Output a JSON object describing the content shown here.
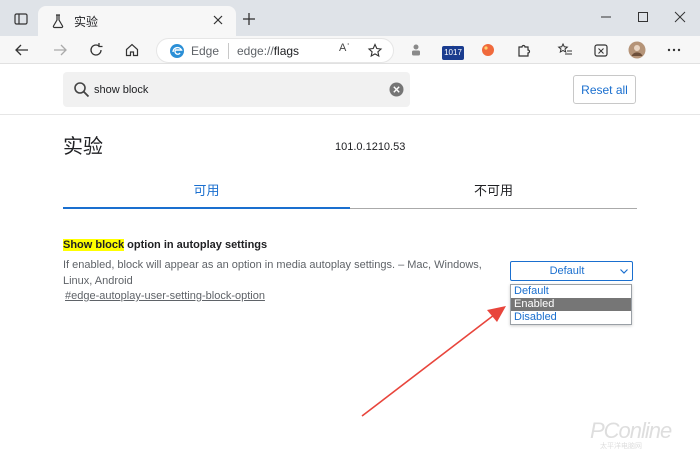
{
  "browser": {
    "tab_title": "实验",
    "site_name": "Edge",
    "url_prefix": "edge://",
    "url_path": "flags",
    "read_aloud_label": "Aʾ",
    "extension_badge": "1017"
  },
  "search": {
    "value": "show block",
    "reset_label": "Reset all"
  },
  "page": {
    "title": "实验",
    "version": "101.0.1210.53",
    "tabs": [
      {
        "label": "可用",
        "active": true
      },
      {
        "label": "不可用",
        "active": false
      }
    ]
  },
  "flag": {
    "title_highlight": "Show block",
    "title_rest": " option in autoplay settings",
    "description": "If enabled, block will appear as an option in media autoplay settings. – Mac, Windows, Linux, Android",
    "link": "#edge-autoplay-user-setting-block-option",
    "select_value": "Default",
    "options": [
      "Default",
      "Enabled",
      "Disabled"
    ],
    "highlighted_option": "Enabled"
  },
  "watermark": {
    "brand": "PConline",
    "sub": "太平洋电脑网"
  },
  "colors": {
    "accent": "#1a6fcf",
    "highlight": "#ffff00",
    "arrow": "#e8453c"
  }
}
